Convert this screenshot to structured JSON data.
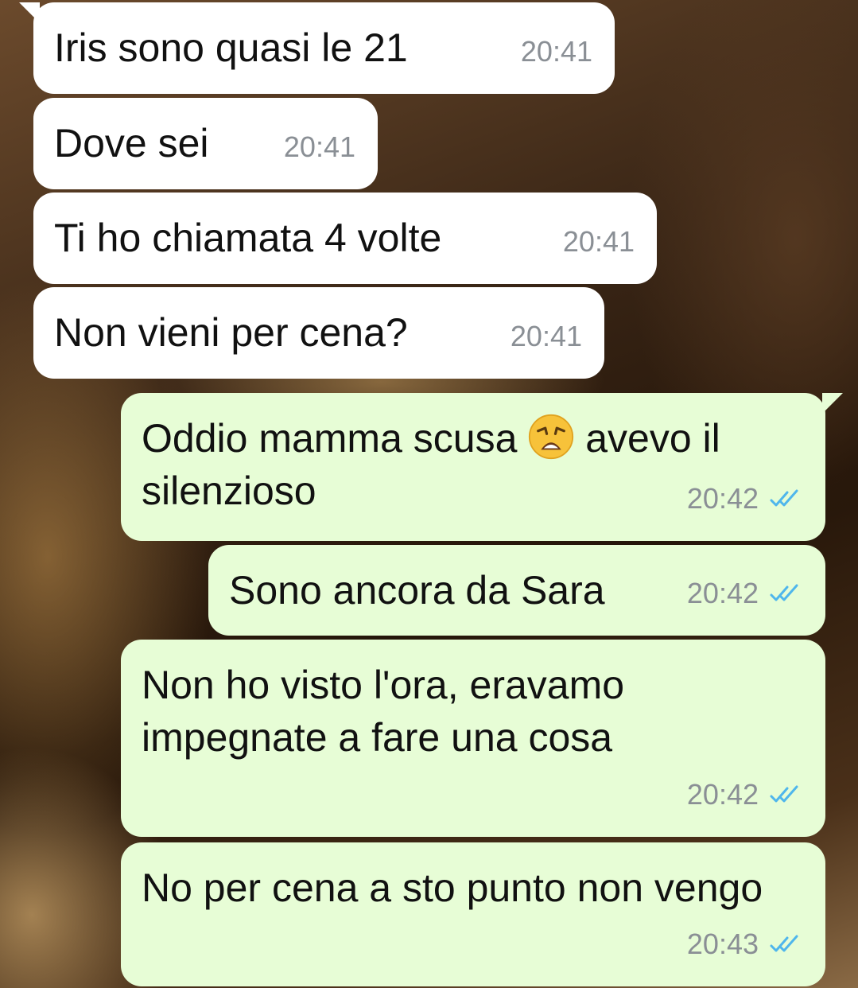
{
  "messages": [
    {
      "direction": "incoming",
      "text": "Iris sono quasi le 21",
      "time": "20:41"
    },
    {
      "direction": "incoming",
      "text": "Dove sei",
      "time": "20:41"
    },
    {
      "direction": "incoming",
      "text": "Ti ho chiamata 4 volte",
      "time": "20:41"
    },
    {
      "direction": "incoming",
      "text": "Non vieni per cena?",
      "time": "20:41"
    },
    {
      "direction": "outgoing",
      "text_before_emoji": "Oddio mamma scusa",
      "emoji": "weary-face-emoji",
      "text_after_emoji": "avevo il silenzioso",
      "time": "20:42",
      "status": "read"
    },
    {
      "direction": "outgoing",
      "text": "Sono ancora da Sara",
      "time": "20:42",
      "status": "read"
    },
    {
      "direction": "outgoing",
      "text": "Non ho visto l'ora, eravamo impegnate a fare una cosa",
      "time": "20:42",
      "status": "read"
    },
    {
      "direction": "outgoing",
      "text": "No per cena a sto punto non vengo",
      "time": "20:43",
      "status": "read"
    }
  ],
  "colors": {
    "incoming_bubble": "#ffffff",
    "outgoing_bubble": "#e7fdd6",
    "read_ticks": "#4fb6ec",
    "timestamp": "#8a8f95"
  }
}
